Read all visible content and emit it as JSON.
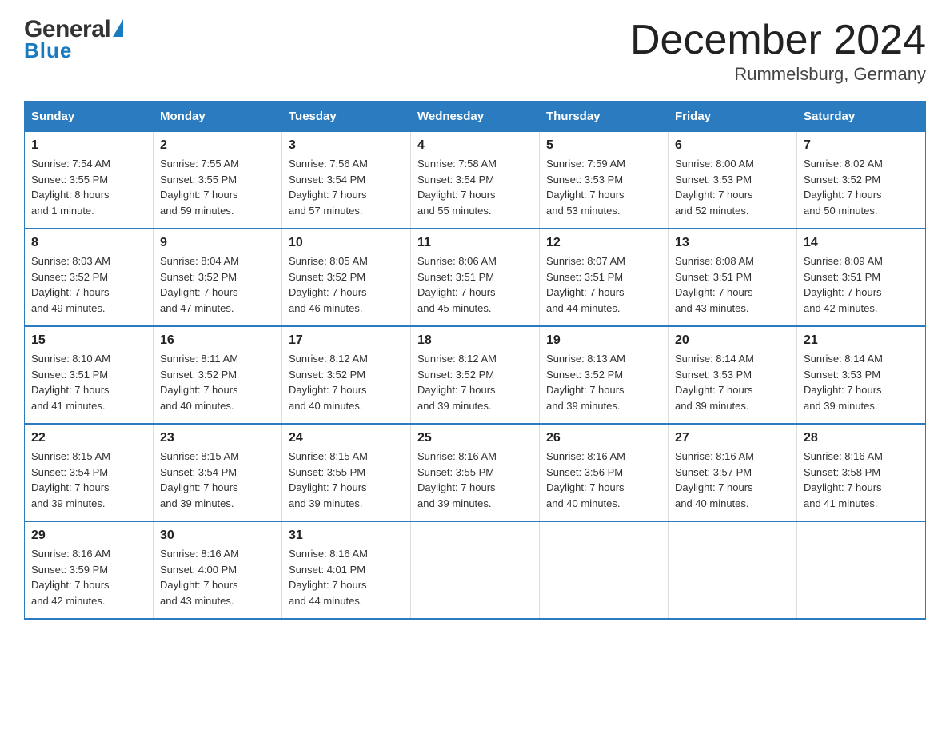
{
  "logo": {
    "general": "General",
    "blue": "Blue",
    "triangle_label": "logo-triangle"
  },
  "title": "December 2024",
  "subtitle": "Rummelsburg, Germany",
  "days_of_week": [
    "Sunday",
    "Monday",
    "Tuesday",
    "Wednesday",
    "Thursday",
    "Friday",
    "Saturday"
  ],
  "weeks": [
    [
      {
        "day": "1",
        "sunrise": "7:54 AM",
        "sunset": "3:55 PM",
        "daylight": "8 hours and 1 minute."
      },
      {
        "day": "2",
        "sunrise": "7:55 AM",
        "sunset": "3:55 PM",
        "daylight": "7 hours and 59 minutes."
      },
      {
        "day": "3",
        "sunrise": "7:56 AM",
        "sunset": "3:54 PM",
        "daylight": "7 hours and 57 minutes."
      },
      {
        "day": "4",
        "sunrise": "7:58 AM",
        "sunset": "3:54 PM",
        "daylight": "7 hours and 55 minutes."
      },
      {
        "day": "5",
        "sunrise": "7:59 AM",
        "sunset": "3:53 PM",
        "daylight": "7 hours and 53 minutes."
      },
      {
        "day": "6",
        "sunrise": "8:00 AM",
        "sunset": "3:53 PM",
        "daylight": "7 hours and 52 minutes."
      },
      {
        "day": "7",
        "sunrise": "8:02 AM",
        "sunset": "3:52 PM",
        "daylight": "7 hours and 50 minutes."
      }
    ],
    [
      {
        "day": "8",
        "sunrise": "8:03 AM",
        "sunset": "3:52 PM",
        "daylight": "7 hours and 49 minutes."
      },
      {
        "day": "9",
        "sunrise": "8:04 AM",
        "sunset": "3:52 PM",
        "daylight": "7 hours and 47 minutes."
      },
      {
        "day": "10",
        "sunrise": "8:05 AM",
        "sunset": "3:52 PM",
        "daylight": "7 hours and 46 minutes."
      },
      {
        "day": "11",
        "sunrise": "8:06 AM",
        "sunset": "3:51 PM",
        "daylight": "7 hours and 45 minutes."
      },
      {
        "day": "12",
        "sunrise": "8:07 AM",
        "sunset": "3:51 PM",
        "daylight": "7 hours and 44 minutes."
      },
      {
        "day": "13",
        "sunrise": "8:08 AM",
        "sunset": "3:51 PM",
        "daylight": "7 hours and 43 minutes."
      },
      {
        "day": "14",
        "sunrise": "8:09 AM",
        "sunset": "3:51 PM",
        "daylight": "7 hours and 42 minutes."
      }
    ],
    [
      {
        "day": "15",
        "sunrise": "8:10 AM",
        "sunset": "3:51 PM",
        "daylight": "7 hours and 41 minutes."
      },
      {
        "day": "16",
        "sunrise": "8:11 AM",
        "sunset": "3:52 PM",
        "daylight": "7 hours and 40 minutes."
      },
      {
        "day": "17",
        "sunrise": "8:12 AM",
        "sunset": "3:52 PM",
        "daylight": "7 hours and 40 minutes."
      },
      {
        "day": "18",
        "sunrise": "8:12 AM",
        "sunset": "3:52 PM",
        "daylight": "7 hours and 39 minutes."
      },
      {
        "day": "19",
        "sunrise": "8:13 AM",
        "sunset": "3:52 PM",
        "daylight": "7 hours and 39 minutes."
      },
      {
        "day": "20",
        "sunrise": "8:14 AM",
        "sunset": "3:53 PM",
        "daylight": "7 hours and 39 minutes."
      },
      {
        "day": "21",
        "sunrise": "8:14 AM",
        "sunset": "3:53 PM",
        "daylight": "7 hours and 39 minutes."
      }
    ],
    [
      {
        "day": "22",
        "sunrise": "8:15 AM",
        "sunset": "3:54 PM",
        "daylight": "7 hours and 39 minutes."
      },
      {
        "day": "23",
        "sunrise": "8:15 AM",
        "sunset": "3:54 PM",
        "daylight": "7 hours and 39 minutes."
      },
      {
        "day": "24",
        "sunrise": "8:15 AM",
        "sunset": "3:55 PM",
        "daylight": "7 hours and 39 minutes."
      },
      {
        "day": "25",
        "sunrise": "8:16 AM",
        "sunset": "3:55 PM",
        "daylight": "7 hours and 39 minutes."
      },
      {
        "day": "26",
        "sunrise": "8:16 AM",
        "sunset": "3:56 PM",
        "daylight": "7 hours and 40 minutes."
      },
      {
        "day": "27",
        "sunrise": "8:16 AM",
        "sunset": "3:57 PM",
        "daylight": "7 hours and 40 minutes."
      },
      {
        "day": "28",
        "sunrise": "8:16 AM",
        "sunset": "3:58 PM",
        "daylight": "7 hours and 41 minutes."
      }
    ],
    [
      {
        "day": "29",
        "sunrise": "8:16 AM",
        "sunset": "3:59 PM",
        "daylight": "7 hours and 42 minutes."
      },
      {
        "day": "30",
        "sunrise": "8:16 AM",
        "sunset": "4:00 PM",
        "daylight": "7 hours and 43 minutes."
      },
      {
        "day": "31",
        "sunrise": "8:16 AM",
        "sunset": "4:01 PM",
        "daylight": "7 hours and 44 minutes."
      },
      null,
      null,
      null,
      null
    ]
  ],
  "labels": {
    "sunrise": "Sunrise:",
    "sunset": "Sunset:",
    "daylight": "Daylight:"
  }
}
